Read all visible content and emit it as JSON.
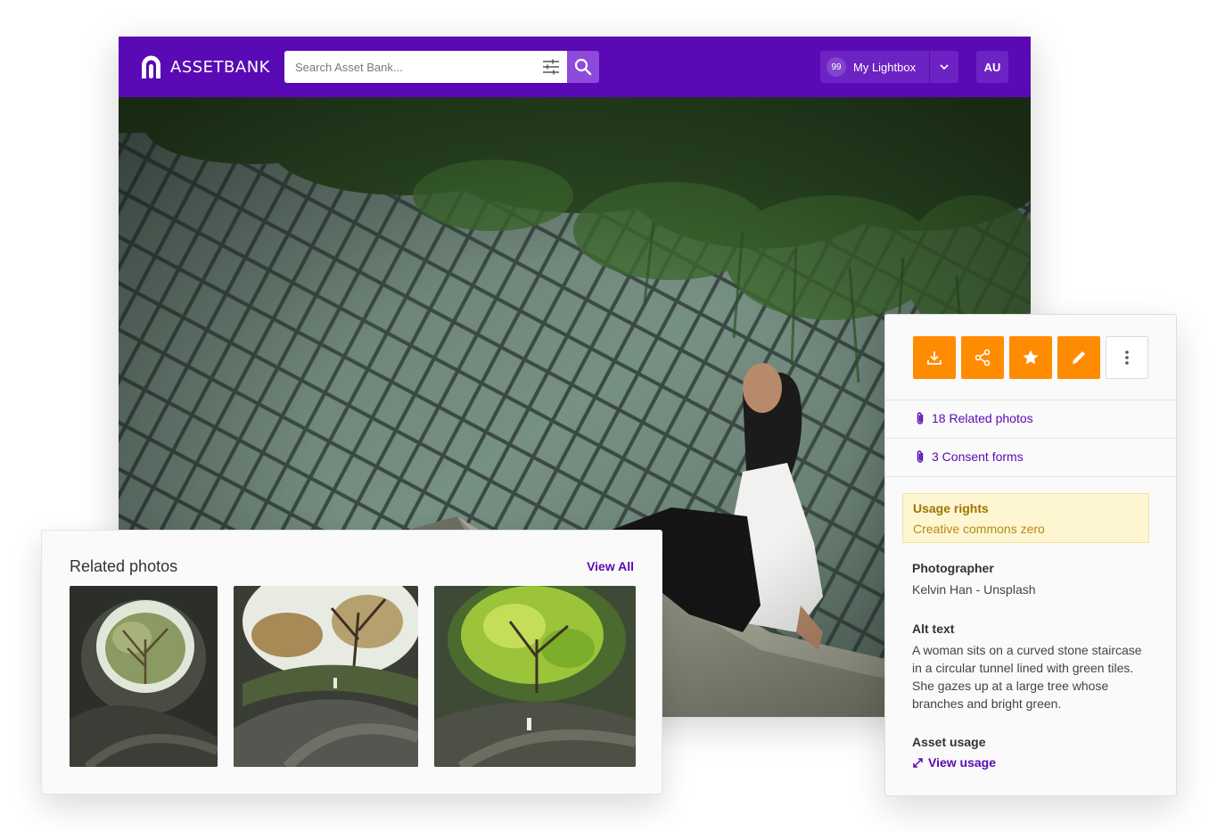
{
  "brand": {
    "name": "ASSETBANK"
  },
  "search": {
    "placeholder": "Search Asset Bank..."
  },
  "header": {
    "lightbox_count": "99",
    "lightbox_label": "My Lightbox",
    "avatar_initials": "AU"
  },
  "icons": {
    "logo": "assetbank-logo-icon",
    "filter": "sliders-icon",
    "search": "search-icon",
    "chevron": "chevron-down-icon",
    "download": "download-icon",
    "share": "share-icon",
    "favourite": "star-icon",
    "edit": "pencil-icon",
    "more": "more-vertical-icon",
    "attachment": "paperclip-icon",
    "expand": "expand-arrows-icon"
  },
  "colors": {
    "brand": "#5a0ab4",
    "accent": "#ff8c00",
    "search_button": "#8e4bdb",
    "rights_bg": "#fdf6d1"
  },
  "related": {
    "title": "Related photos",
    "view_all": "View All",
    "thumbnails": 3
  },
  "panel": {
    "related_link": "18 Related photos",
    "consent_link": "3 Consent forms",
    "usage_rights_label": "Usage rights",
    "usage_rights_value": "Creative commons zero",
    "photographer_label": "Photographer",
    "photographer_value": "Kelvin Han - Unsplash",
    "alt_text_label": "Alt text",
    "alt_text_value": "A woman sits on a curved stone staircase in a circular tunnel lined with green tiles. She gazes up at a large tree whose branches and bright green.",
    "asset_usage_label": "Asset usage",
    "view_usage": "View usage"
  }
}
